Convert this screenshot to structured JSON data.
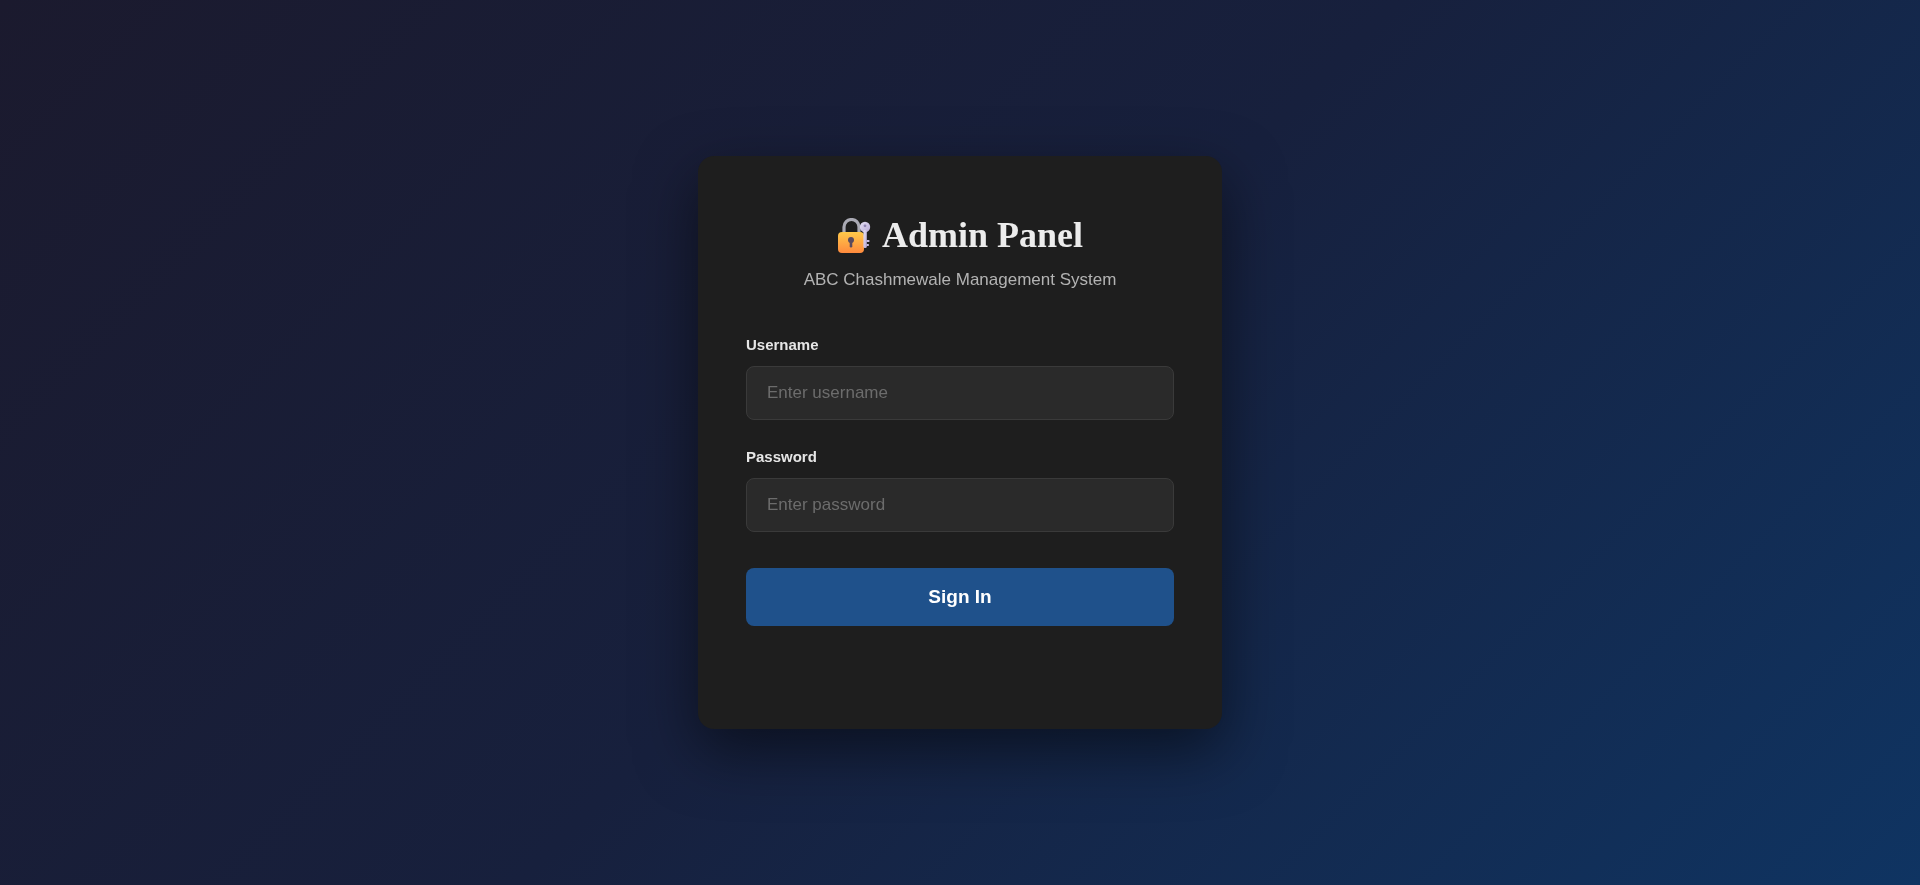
{
  "header": {
    "title": "Admin Panel",
    "subtitle": "ABC Chashmewale Management System"
  },
  "fields": [
    {
      "label": "Username",
      "placeholder": "Enter username"
    },
    {
      "label": "Password",
      "placeholder": "Enter password"
    }
  ],
  "submit_button": {
    "label": "Sign In"
  }
}
